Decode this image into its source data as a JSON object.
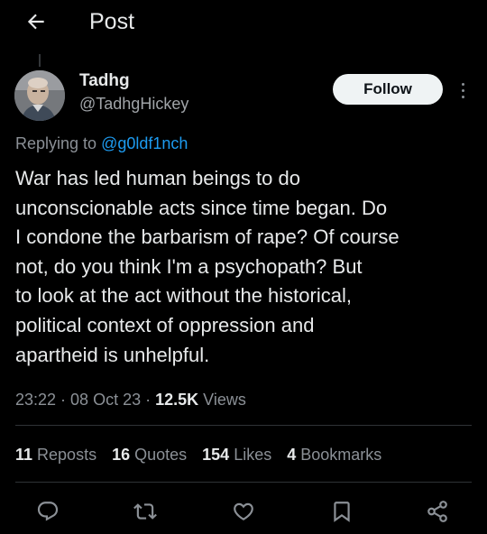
{
  "header": {
    "title": "Post"
  },
  "author": {
    "name": "Tadhg",
    "handle": "@TadhgHickey"
  },
  "follow_label": "Follow",
  "reply": {
    "prefix": "Replying to ",
    "mention": "@g0ldf1nch"
  },
  "tweet": {
    "lines": [
      "War has led human beings to do",
      "unconscionable acts since time began. Do",
      "I condone the barbarism of rape? Of course",
      "not, do you think I'm a psychopath? But",
      "to look at the act without the historical,",
      "political context of oppression and",
      "apartheid is unhelpful."
    ]
  },
  "meta": {
    "time": "23:22",
    "sep1": " · ",
    "date": "08 Oct 23",
    "sep2": " · ",
    "views_count": "12.5K",
    "views_label": " Views"
  },
  "stats": {
    "reposts_count": "11",
    "reposts_label": " Reposts",
    "quotes_count": "16",
    "quotes_label": " Quotes",
    "likes_count": "154",
    "likes_label": " Likes",
    "bookmarks_count": "4",
    "bookmarks_label": " Bookmarks"
  },
  "actions": [
    "reply-icon",
    "repost-icon",
    "like-icon",
    "bookmark-icon",
    "share-icon"
  ],
  "colors": {
    "background": "#000000",
    "text": "#e7e9ea",
    "secondary": "#8b9096",
    "link": "#1d9bf0",
    "follow_bg": "#eff3f4",
    "divider": "#2f3336"
  }
}
